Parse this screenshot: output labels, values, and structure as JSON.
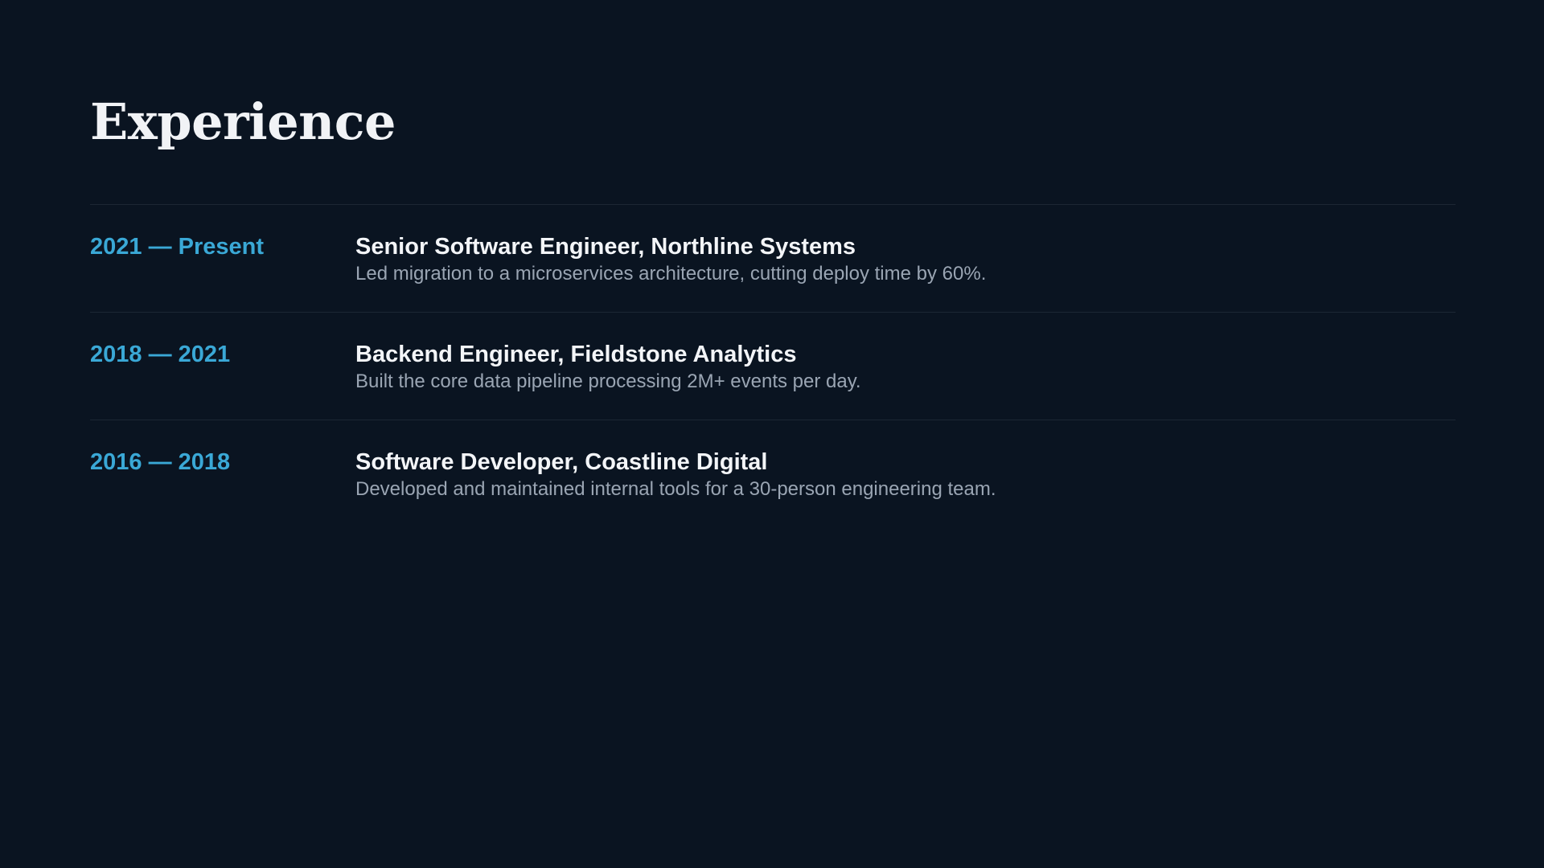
{
  "page": {
    "title": "Experience"
  },
  "colors": {
    "background": "#0a1421",
    "accent": "#3aa8d6",
    "divider": "#1c2734"
  },
  "experience": [
    {
      "period": "2021 — Present",
      "role": "Senior Software Engineer, Northline Systems",
      "description": "Led migration to a microservices architecture, cutting deploy time by 60%."
    },
    {
      "period": "2018 — 2021",
      "role": "Backend Engineer, Fieldstone Analytics",
      "description": "Built the core data pipeline processing 2M+ events per day."
    },
    {
      "period": "2016 — 2018",
      "role": "Software Developer, Coastline Digital",
      "description": "Developed and maintained internal tools for a 30-person engineering team."
    }
  ]
}
